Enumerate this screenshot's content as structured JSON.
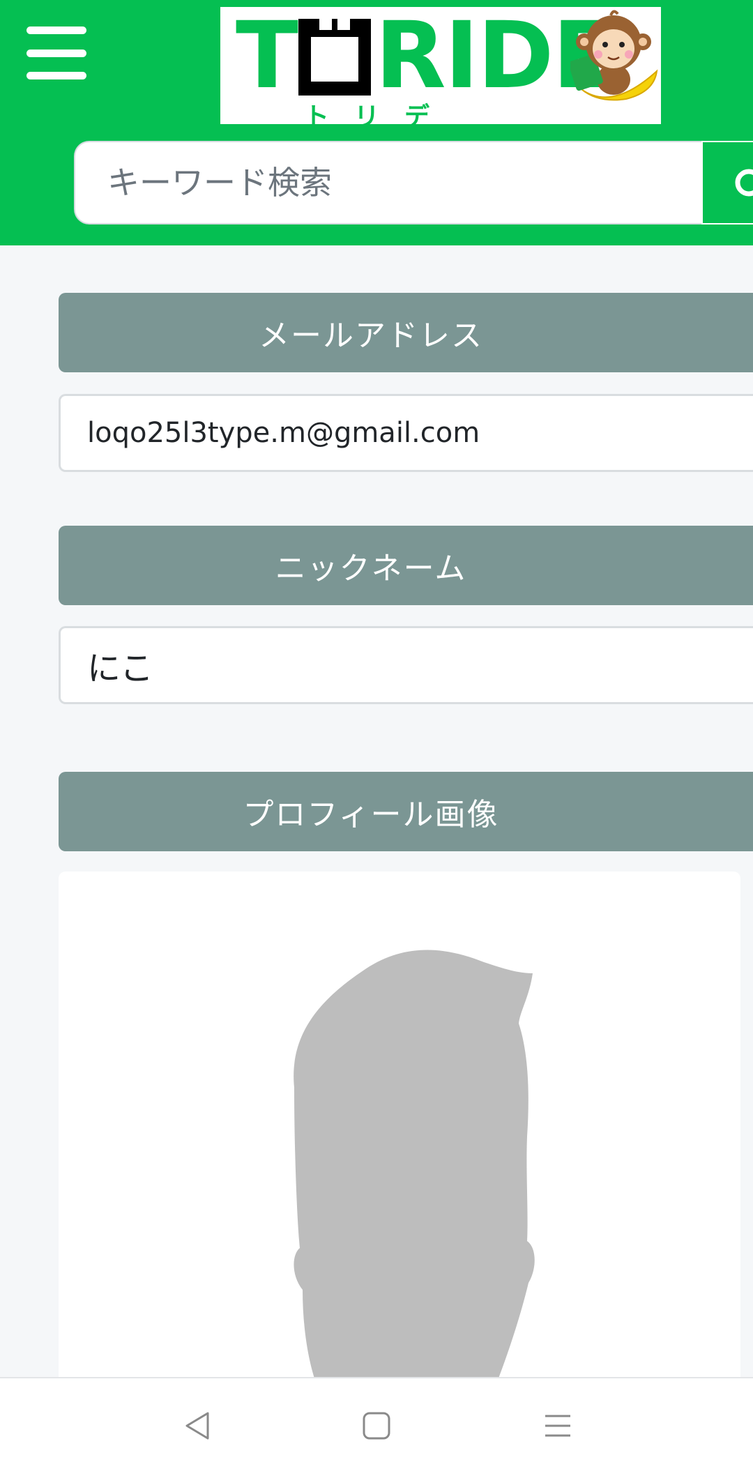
{
  "header": {
    "logo_text_before": "T",
    "logo_text_after": "RIDE",
    "logo_subtitle": "トリデ",
    "search_placeholder": "キーワード検索"
  },
  "form": {
    "email_label": "メールアドレス",
    "email_value": "loqo25l3type.m@gmail.com",
    "nickname_label": "ニックネーム",
    "nickname_value": "にこ",
    "profile_image_label": "プロフィール画像"
  },
  "icons": {
    "menu": "hamburger-icon",
    "search": "search-icon",
    "avatar": "avatar-placeholder",
    "back": "back-icon",
    "home": "home-icon",
    "recents": "recents-icon"
  },
  "colors": {
    "brand": "#05bf52",
    "label_bg": "#7b9694",
    "avatar_silhouette": "#bdbdbd"
  }
}
